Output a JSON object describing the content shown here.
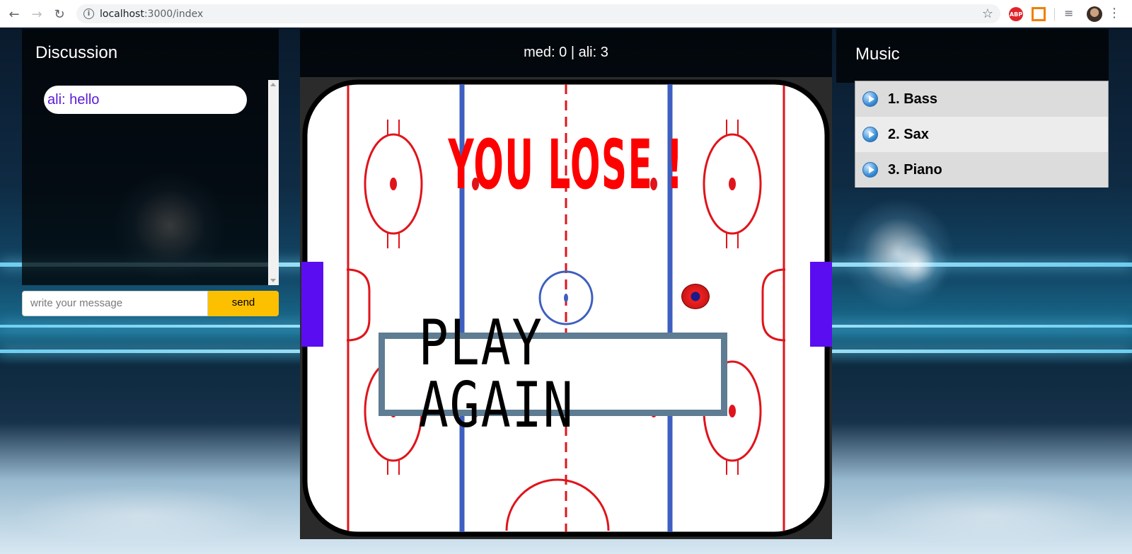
{
  "browser": {
    "url_host": "localhost",
    "url_path": ":3000/index",
    "back_glyph": "←",
    "forward_glyph": "→",
    "reload_glyph": "↻",
    "info_glyph": "i",
    "star_glyph": "☆",
    "abp_label": "ABP",
    "playlist_glyph": "≡",
    "menu_glyph": "⋮"
  },
  "discussion": {
    "title": "Discussion",
    "messages": [
      {
        "text": "ali: hello"
      }
    ],
    "input_placeholder": "write your message",
    "send_label": "send"
  },
  "game": {
    "score": "med: 0 | ali: 3",
    "result_text": "YOU LOSE !",
    "play_again_label": "PLAY AGAIN"
  },
  "music": {
    "title": "Music",
    "tracks": [
      {
        "label": "1. Bass"
      },
      {
        "label": "2. Sax"
      },
      {
        "label": "3. Piano"
      }
    ]
  },
  "colors": {
    "paddle": "#5b0df2",
    "send_button": "#fcc000",
    "chat_text": "#5a1ad6",
    "lose_text": "#ff0000",
    "play_again_border": "#5e7c92"
  }
}
